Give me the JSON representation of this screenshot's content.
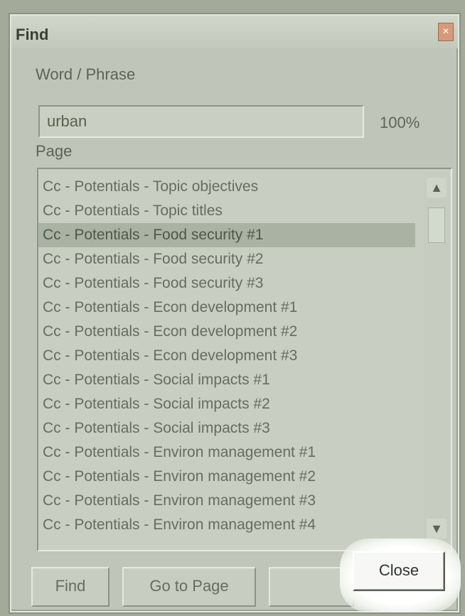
{
  "dialog": {
    "title": "Find",
    "close_glyph": "×"
  },
  "search": {
    "label": "Word / Phrase",
    "value": "urban",
    "percent": "100%"
  },
  "page": {
    "label": "Page",
    "items": [
      "Cc - Potentials - Topic objectives",
      "Cc - Potentials - Topic titles",
      "Cc - Potentials - Food security #1",
      "Cc - Potentials - Food security #2",
      "Cc - Potentials - Food security #3",
      "Cc - Potentials - Econ development #1",
      "Cc - Potentials - Econ development #2",
      "Cc - Potentials - Econ development #3",
      "Cc - Potentials - Social impacts #1",
      "Cc - Potentials - Social impacts #2",
      "Cc - Potentials - Social impacts #3",
      "Cc - Potentials - Environ management #1",
      "Cc - Potentials - Environ management #2",
      "Cc - Potentials - Environ management #3",
      "Cc - Potentials - Environ management #4"
    ],
    "selected_index": 2
  },
  "buttons": {
    "find": "Find",
    "go_to_page": "Go to Page",
    "disabled": "",
    "close": "Close"
  },
  "scroll": {
    "up_icon": "▲",
    "down_icon": "▼"
  }
}
